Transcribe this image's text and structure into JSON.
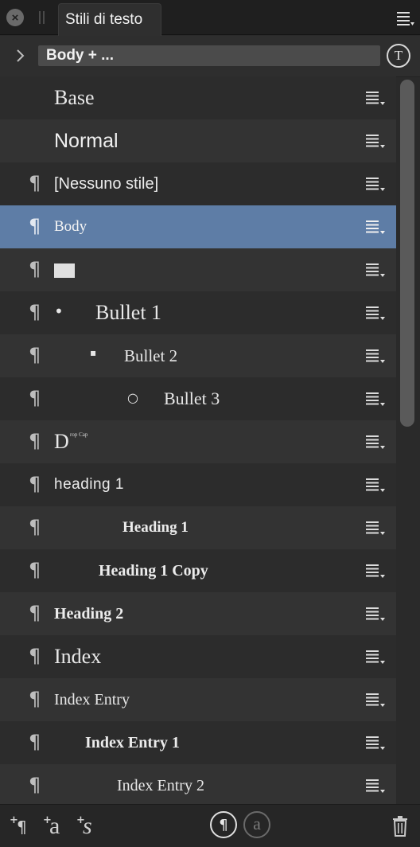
{
  "tab": {
    "title": "Stili di testo"
  },
  "header": {
    "current_style": "Body + ..."
  },
  "styles": [
    {
      "label": "Base"
    },
    {
      "label": "Normal"
    },
    {
      "label": "[Nessuno stile]"
    },
    {
      "label": "Body"
    },
    {
      "label": ""
    },
    {
      "label": "Bullet 1",
      "bullet": "•"
    },
    {
      "label": "Bullet 2",
      "bullet": "▪"
    },
    {
      "label": "Bullet 3",
      "bullet": "○"
    },
    {
      "label": "D",
      "sub": "rop Cap"
    },
    {
      "label": "heading 1"
    },
    {
      "label": "Heading 1"
    },
    {
      "label": "Heading 1 Copy"
    },
    {
      "label": "Heading 2"
    },
    {
      "label": "Index"
    },
    {
      "label": "Index Entry"
    },
    {
      "label": "Index Entry 1"
    },
    {
      "label": "Index Entry 2"
    }
  ],
  "selected_style": "Body",
  "colors": {
    "selection": "#5e7da6",
    "panel": "#2a2a2a"
  }
}
